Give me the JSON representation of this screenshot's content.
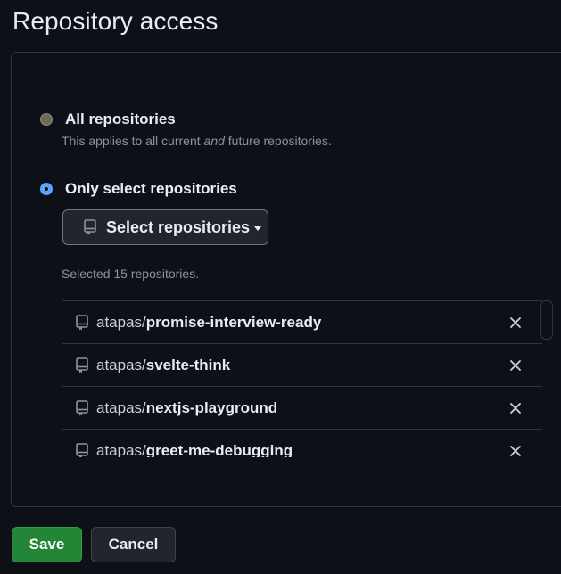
{
  "page": {
    "title": "Repository access"
  },
  "access_options": {
    "all": {
      "label": "All repositories",
      "description_pre": "This applies to all current ",
      "description_em": "and",
      "description_post": " future repositories.",
      "selected": false
    },
    "select": {
      "label": "Only select repositories",
      "selected": true
    }
  },
  "select_button": {
    "label": "Select repositories",
    "icon": "repo-icon"
  },
  "selected_summary": "Selected 15 repositories.",
  "repositories": [
    {
      "owner": "atapas/",
      "name": "promise-interview-ready"
    },
    {
      "owner": "atapas/",
      "name": "svelte-think"
    },
    {
      "owner": "atapas/",
      "name": "nextjs-playground"
    },
    {
      "owner": "atapas/",
      "name": "greet-me-debugging"
    }
  ],
  "actions": {
    "save_label": "Save",
    "cancel_label": "Cancel"
  },
  "colors": {
    "background": "#0d1117",
    "border": "#30363d",
    "accent": "#58a6ff",
    "primary_button": "#238636",
    "muted_text": "#8b949e"
  }
}
